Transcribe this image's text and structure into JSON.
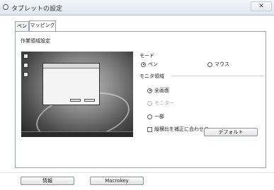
{
  "window": {
    "title": "タブレットの設定",
    "close_glyph": "✕"
  },
  "tabs": [
    {
      "label": "ペン",
      "selected": false
    },
    {
      "label": "マッピング",
      "selected": true
    }
  ],
  "work_area": {
    "title": "作業領域設定"
  },
  "mode": {
    "title": "モード",
    "options": [
      {
        "label": "ペン",
        "selected": true,
        "enabled": true
      },
      {
        "label": "マウス",
        "selected": false,
        "enabled": true
      }
    ]
  },
  "monitor_area": {
    "title": "モニタ領域",
    "options": [
      {
        "label": "全画面",
        "selected": true,
        "enabled": true
      },
      {
        "label": "モニター",
        "selected": false,
        "enabled": false
      },
      {
        "label": "一部",
        "selected": false,
        "enabled": true
      }
    ],
    "checkbox": {
      "label": "縦横比を補正に合わせる",
      "checked": false
    }
  },
  "buttons": {
    "default": "デフォルト",
    "info": "情報",
    "macrokey": "Macrokey"
  },
  "icons": {
    "app": "tablet-settings-icon",
    "close": "close-icon"
  }
}
